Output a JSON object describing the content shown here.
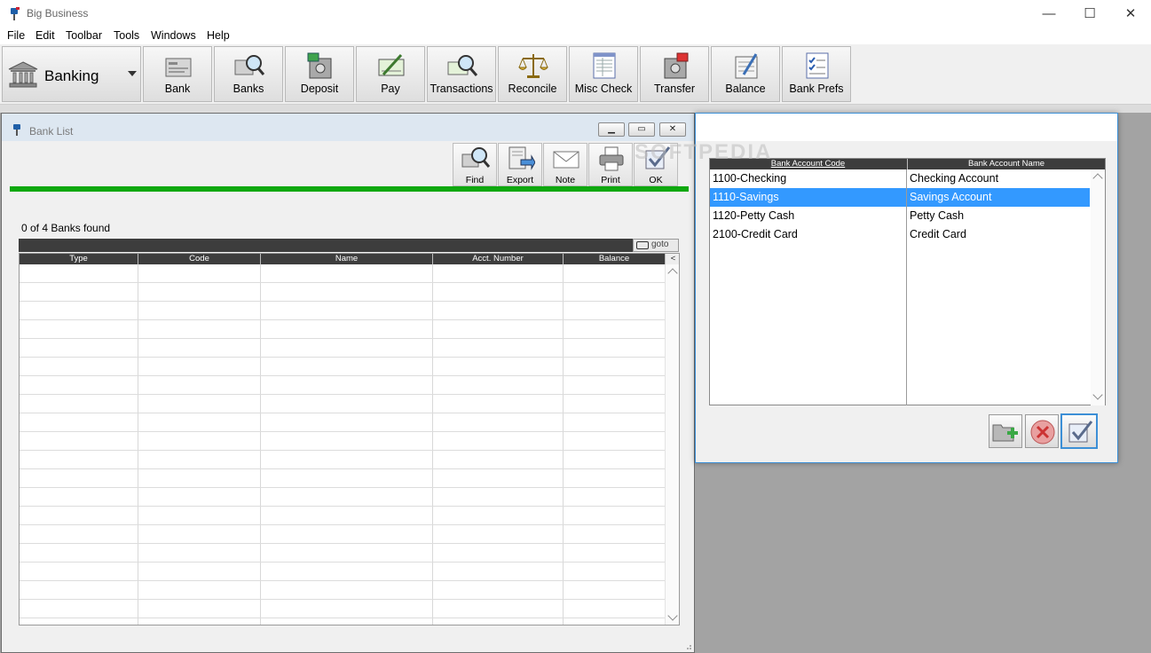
{
  "window": {
    "title": "Big Business",
    "controls": {
      "minimize": "—",
      "maximize": "☐",
      "close": "✕"
    }
  },
  "menu": [
    "File",
    "Edit",
    "Toolbar",
    "Tools",
    "Windows",
    "Help"
  ],
  "toolbar": {
    "module": "Banking",
    "buttons": [
      {
        "label": "Bank",
        "icon": "bank-card-icon"
      },
      {
        "label": "Banks",
        "icon": "banks-search-icon"
      },
      {
        "label": "Deposit",
        "icon": "deposit-safe-icon"
      },
      {
        "label": "Pay",
        "icon": "pay-check-icon"
      },
      {
        "label": "Transactions",
        "icon": "transactions-search-icon"
      },
      {
        "label": "Reconcile",
        "icon": "scales-icon"
      },
      {
        "label": "Misc Check",
        "icon": "ledger-icon"
      },
      {
        "label": "Transfer",
        "icon": "transfer-safe-icon"
      },
      {
        "label": "Balance",
        "icon": "balance-sheet-icon"
      },
      {
        "label": "Bank Prefs",
        "icon": "checklist-icon"
      }
    ]
  },
  "bank_list": {
    "title": "Bank List",
    "tools": [
      {
        "label": "Find",
        "icon": "find-icon"
      },
      {
        "label": "Export",
        "icon": "export-icon"
      },
      {
        "label": "Note",
        "icon": "envelope-icon"
      },
      {
        "label": "Print",
        "icon": "printer-icon"
      },
      {
        "label": "OK",
        "icon": "checkmark-icon"
      }
    ],
    "found_text": "0 of 4 Banks found",
    "goto_label": "goto",
    "columns": [
      "Type",
      "Code",
      "Name",
      "Acct. Number",
      "Balance"
    ],
    "collapse_glyph": "<",
    "accent_color": "#0ea80e"
  },
  "account_dialog": {
    "columns": [
      "Bank Account Code",
      "Bank Account Name"
    ],
    "rows": [
      {
        "code": "1100-Checking",
        "name": "Checking Account",
        "selected": false
      },
      {
        "code": "1110-Savings",
        "name": "Savings Account",
        "selected": true
      },
      {
        "code": "1120-Petty Cash",
        "name": "Petty Cash",
        "selected": false
      },
      {
        "code": "2100-Credit Card",
        "name": "Credit Card",
        "selected": false
      }
    ],
    "selection_color": "#3399ff"
  },
  "watermark": "SOFTPEDIA"
}
